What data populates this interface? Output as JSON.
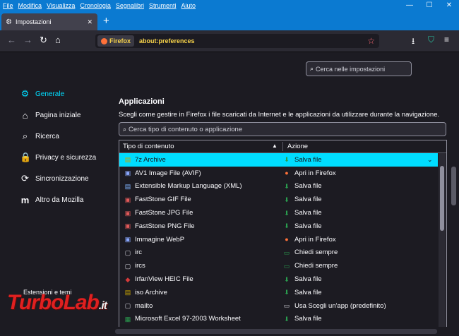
{
  "menu": [
    "File",
    "Modifica",
    "Visualizza",
    "Cronologia",
    "Segnalibri",
    "Strumenti",
    "Aiuto"
  ],
  "window_controls": {
    "minimize": "—",
    "maximize": "☐",
    "close": "✕"
  },
  "tab": {
    "title": "Impostazioni",
    "icon": "gear-icon",
    "close": "✕",
    "new_tab": "+"
  },
  "toolbar": {
    "back": "←",
    "forward": "→",
    "reload": "↻",
    "home": "⌂",
    "identity": "Firefox",
    "url": "about:preferences",
    "bookmark": "☆",
    "downloads": "⭳",
    "extension": "⛉",
    "menu": "≡"
  },
  "search": {
    "placeholder": "Cerca nelle impostazioni",
    "icon": "⌕"
  },
  "sidebar": {
    "items": [
      {
        "icon": "⚙",
        "label": "Generale",
        "selected": true
      },
      {
        "icon": "⌂",
        "label": "Pagina iniziale"
      },
      {
        "icon": "⌕",
        "label": "Ricerca"
      },
      {
        "icon": "🔒",
        "label": "Privacy e sicurezza"
      },
      {
        "icon": "⟳",
        "label": "Sincronizzazione"
      },
      {
        "icon": "m",
        "label": "Altro da Mozilla"
      }
    ],
    "bottom": "Estensioni e temi"
  },
  "section": {
    "title": "Applicazioni",
    "description": "Scegli come gestire in Firefox i file scaricati da Internet e le applicazioni da utilizzare durante la navigazione.",
    "filter_placeholder": "Cerca tipo di contenuto o applicazione",
    "col_type": "Tipo di contenuto",
    "col_action": "Azione",
    "sort_icon": "▲"
  },
  "rows": [
    {
      "type": "7z Archive",
      "action": "Salva file",
      "ticon": "▤",
      "aicon": "⬇",
      "selected": true
    },
    {
      "type": "AV1 Image File (AVIF)",
      "action": "Apri in Firefox",
      "ticon": "▣",
      "aicon": "●"
    },
    {
      "type": "Extensible Markup Language (XML)",
      "action": "Salva file",
      "ticon": "▤",
      "aicon": "⬇"
    },
    {
      "type": "FastStone GIF File",
      "action": "Salva file",
      "ticon": "▣",
      "aicon": "⬇"
    },
    {
      "type": "FastStone JPG File",
      "action": "Salva file",
      "ticon": "▣",
      "aicon": "⬇"
    },
    {
      "type": "FastStone PNG File",
      "action": "Salva file",
      "ticon": "▣",
      "aicon": "⬇"
    },
    {
      "type": "Immagine WebP",
      "action": "Apri in Firefox",
      "ticon": "▣",
      "aicon": "●"
    },
    {
      "type": "irc",
      "action": "Chiedi sempre",
      "ticon": "▢",
      "aicon": "▭"
    },
    {
      "type": "ircs",
      "action": "Chiedi sempre",
      "ticon": "▢",
      "aicon": "▭"
    },
    {
      "type": "IrfanView HEIC File",
      "action": "Salva file",
      "ticon": "◆",
      "aicon": "⬇"
    },
    {
      "type": "iso Archive",
      "action": "Salva file",
      "ticon": "▤",
      "aicon": "⬇"
    },
    {
      "type": "mailto",
      "action": "Usa Scegli un'app (predefinito)",
      "ticon": "▢",
      "aicon": "▭"
    },
    {
      "type": "Microsoft Excel 97-2003 Worksheet",
      "action": "Salva file",
      "ticon": "▦",
      "aicon": "⬇"
    }
  ],
  "selected_chevron": "⌄",
  "watermark": {
    "turbo": "Turbo",
    "lab": "Lab",
    "it": ".it"
  }
}
